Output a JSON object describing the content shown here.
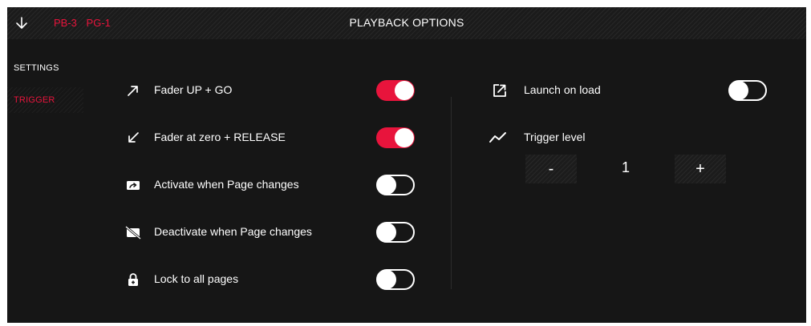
{
  "header": {
    "title": "PLAYBACK OPTIONS",
    "breadcrumbs": [
      "PB-3",
      "PG-1"
    ]
  },
  "sidebar": {
    "items": [
      {
        "label": "SETTINGS",
        "active": false
      },
      {
        "label": "TRIGGER",
        "active": true
      }
    ]
  },
  "left_options": [
    {
      "label": "Fader UP + GO",
      "icon": "arrow-up-right-icon",
      "enabled": true
    },
    {
      "label": "Fader at zero + RELEASE",
      "icon": "arrow-down-left-icon",
      "enabled": true
    },
    {
      "label": "Activate when Page changes",
      "icon": "page-activate-icon",
      "enabled": false
    },
    {
      "label": "Deactivate when Page changes",
      "icon": "page-deactivate-icon",
      "enabled": false
    },
    {
      "label": "Lock to all pages",
      "icon": "lock-icon",
      "enabled": false
    }
  ],
  "right_options": {
    "launch_on_load": {
      "label": "Launch on load",
      "icon": "open-external-icon",
      "enabled": false
    },
    "trigger_level": {
      "label": "Trigger level",
      "icon": "trend-line-icon",
      "value": "1",
      "minus_label": "-",
      "plus_label": "+"
    }
  },
  "colors": {
    "accent": "#e8143c",
    "background": "#161616",
    "text": "#ffffff"
  }
}
